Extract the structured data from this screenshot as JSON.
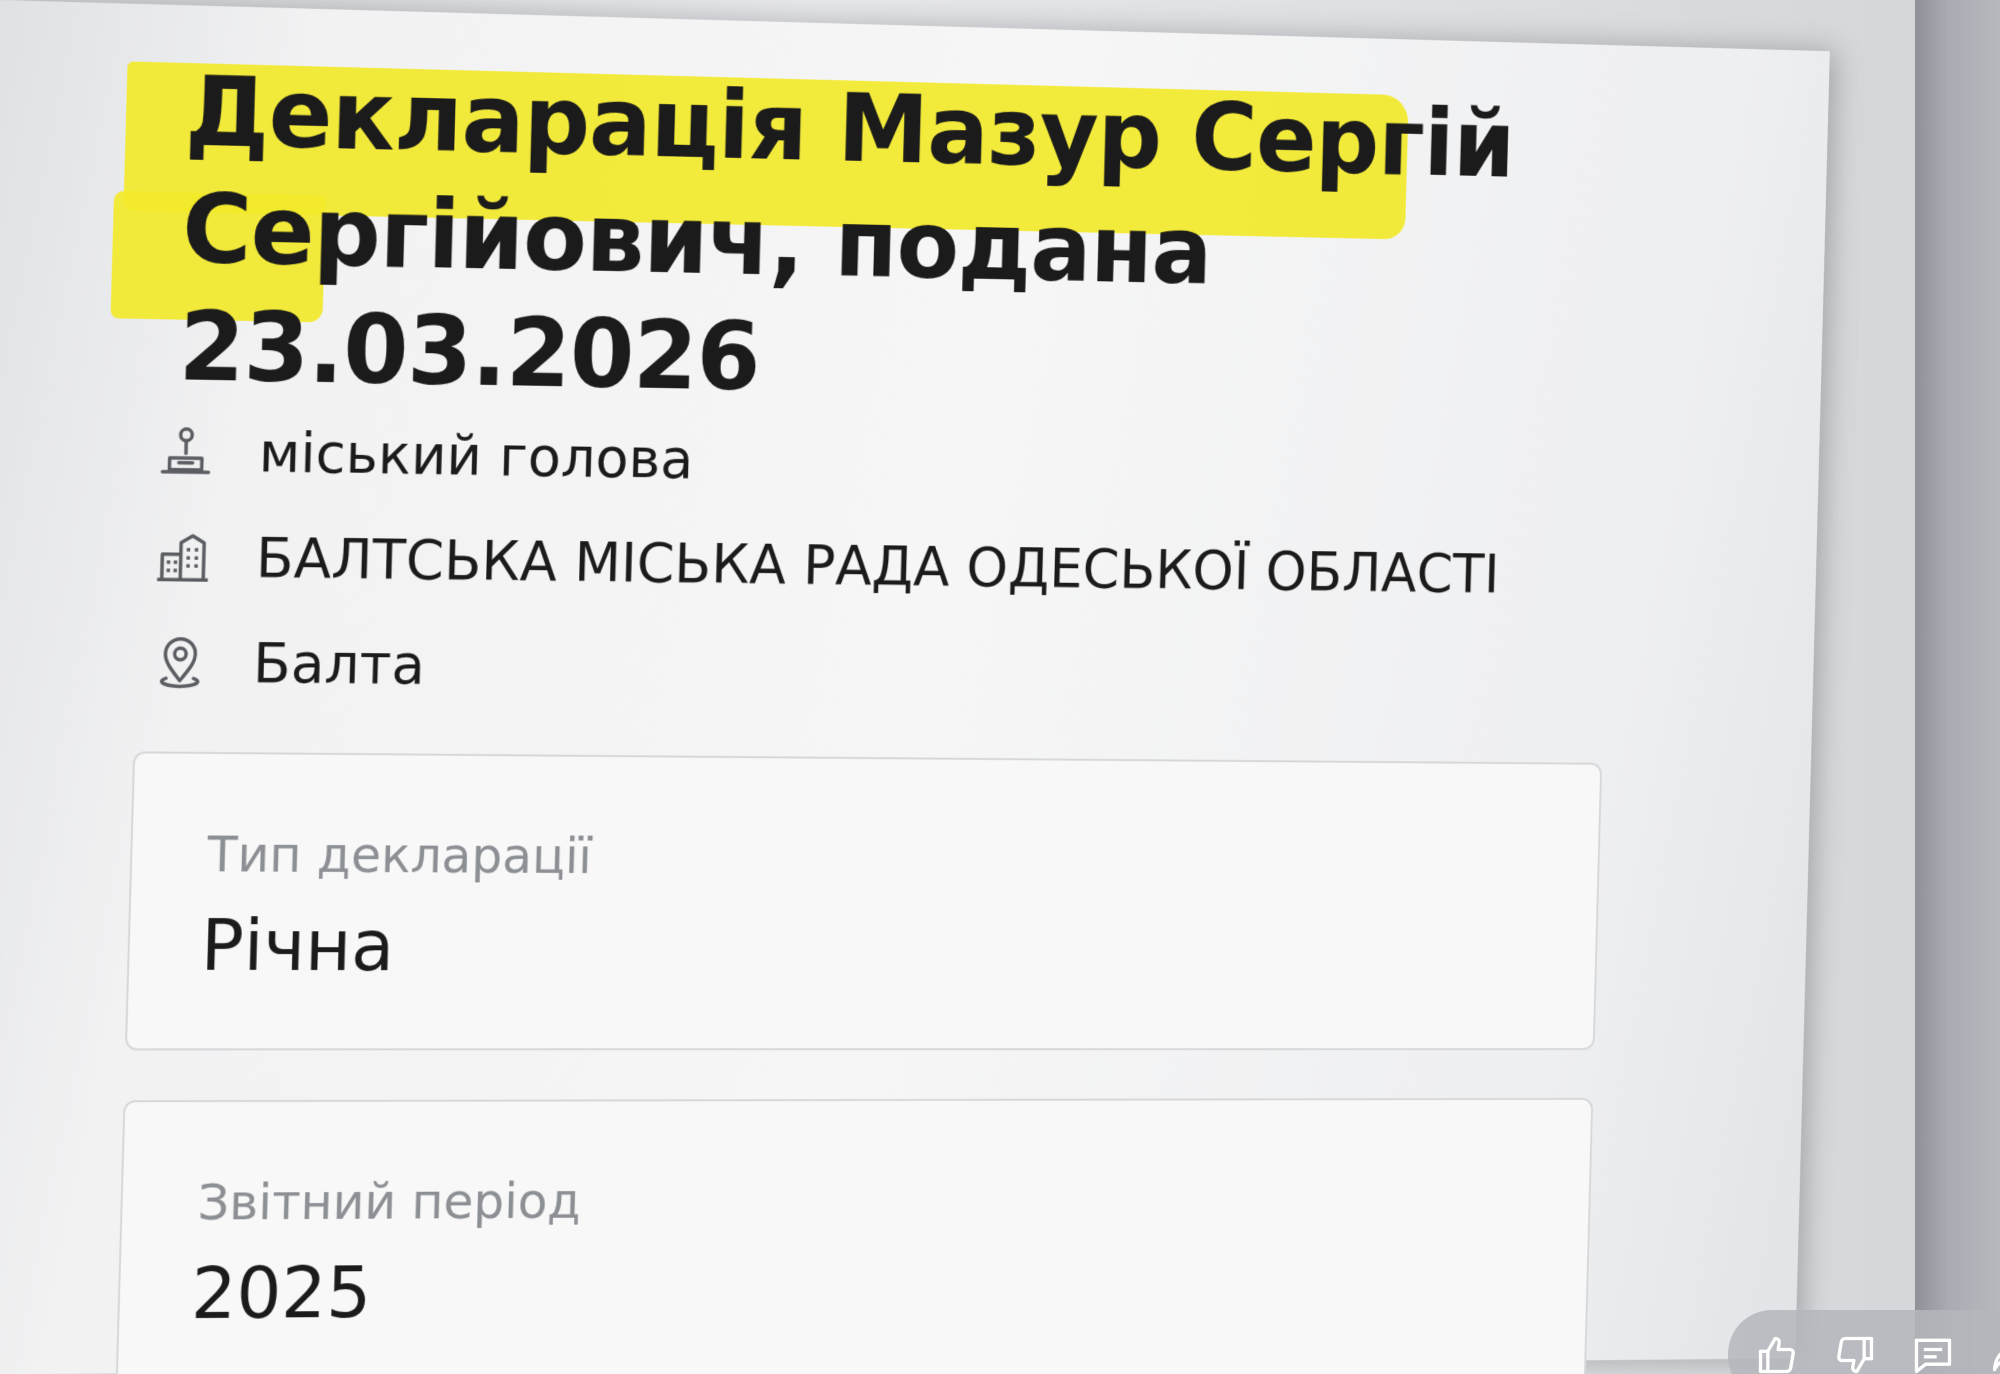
{
  "declaration": {
    "title": "Декларація Мазур Сергій Сергійович, подана 23.03.2026",
    "position": "міський голова",
    "organization": "БАЛТСЬКА МІСЬКА РАДА ОДЕСЬКОЇ ОБЛАСТІ",
    "city": "Балта",
    "highlight_color": "#f2e92a"
  },
  "fields": [
    {
      "label": "Тип декларації",
      "value": "Річна"
    },
    {
      "label": "Звітний період",
      "value": "2025"
    }
  ],
  "icons": {
    "position": "person-badge-icon",
    "organization": "building-icon",
    "city": "map-pin-icon"
  },
  "overlay": {
    "actions": [
      "thumbs-up-icon",
      "thumbs-down-icon",
      "comment-icon",
      "share-icon"
    ]
  }
}
